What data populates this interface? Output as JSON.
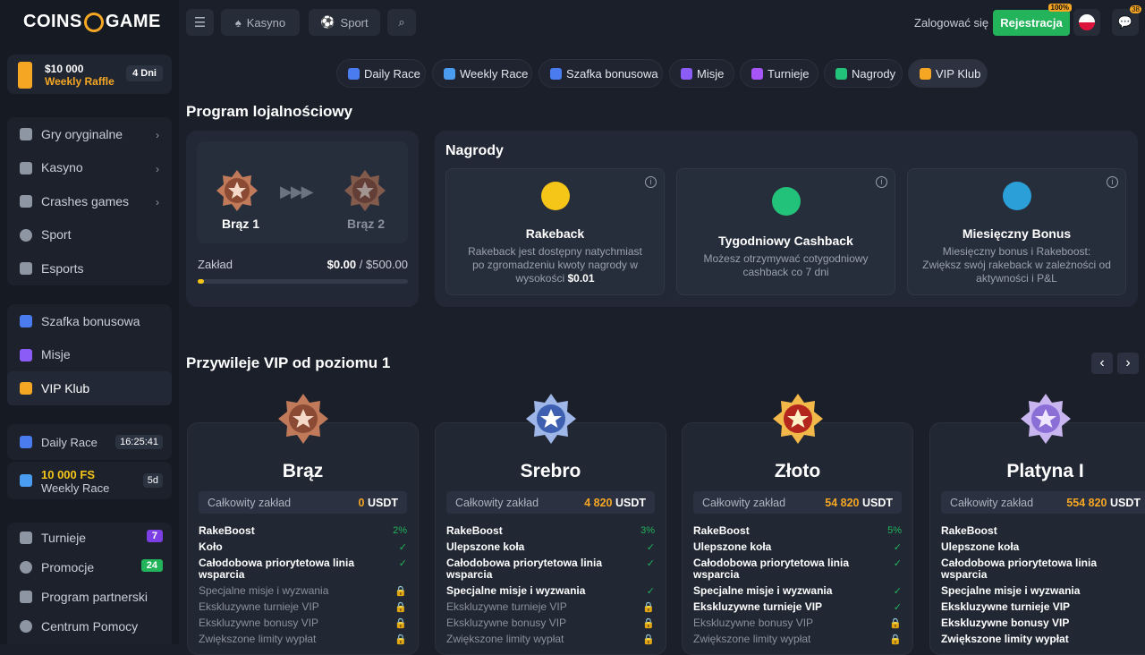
{
  "sidebar": {
    "logo_left": "COINS",
    "logo_right": "GAME",
    "raffle": {
      "amount": "$10 000",
      "label": "Weekly Raffle",
      "days": "4 Dni"
    },
    "menu1": [
      {
        "label": "Gry oryginalne",
        "icon": "rocket-icon"
      },
      {
        "label": "Kasyno",
        "icon": "spade-icon"
      },
      {
        "label": "Crashes games",
        "icon": "crash-icon"
      },
      {
        "label": "Sport",
        "icon": "ball-icon"
      },
      {
        "label": "Esports",
        "icon": "gamepad-icon"
      }
    ],
    "menu2": [
      {
        "label": "Szafka bonusowa",
        "icon": "gift-icon"
      },
      {
        "label": "Misje",
        "icon": "grid-icon"
      },
      {
        "label": "VIP Klub",
        "icon": "crown-icon"
      }
    ],
    "daily_race": {
      "label": "Daily Race",
      "timer": "16:25:41"
    },
    "weekly_race": {
      "amount": "10 000 FS",
      "label": "Weekly Race",
      "days": "5d"
    },
    "menu3": [
      {
        "label": "Turnieje",
        "badge": "7",
        "badge_color": "#7b3fe4"
      },
      {
        "label": "Promocje",
        "badge": "24",
        "badge_color": "#22b35b"
      },
      {
        "label": "Program partnerski"
      },
      {
        "label": "Centrum Pomocy"
      }
    ]
  },
  "topbar": {
    "casino": "Kasyno",
    "sport": "Sport",
    "login": "Zalogować się",
    "register": "Rejestracja",
    "register_badge": "100%",
    "chat_badge": "38"
  },
  "tabs": [
    "Daily Race",
    "Weekly Race",
    "Szafka bonusowa",
    "Misje",
    "Turnieje",
    "Nagrody",
    "VIP Klub"
  ],
  "loyalty": {
    "heading": "Program lojalnościowy",
    "current": "Brąz 1",
    "next": "Brąz 2",
    "wager_label": "Zakład",
    "wager_value": "$0.00",
    "wager_target": "/ $500.00",
    "progress": 0.03
  },
  "rewards": {
    "heading": "Nagrody",
    "cards": [
      {
        "title": "Rakeback",
        "desc": "Rakeback jest dostępny natychmiast po zgromadzeniu kwoty nagrody w wysokości",
        "desc_bold": "$0.01",
        "color": "#f5c518"
      },
      {
        "title": "Tygodniowy Cashback",
        "desc": "Możesz otrzymywać cotygodniowy cashback co 7 dni",
        "desc_bold": "",
        "color": "#22c27a"
      },
      {
        "title": "Miesięczny Bonus",
        "desc": "Miesięczny bonus i Rakeboost: Zwiększ swój rakeback w zależności od aktywności i P&L",
        "desc_bold": "",
        "color": "#2a9fd8"
      }
    ]
  },
  "vip": {
    "heading": "Przywileje VIP od poziomu 1",
    "wager_label": "Całkowity zakład",
    "currency": "USDT",
    "tiers": [
      {
        "name": "Brąz",
        "wager": "0",
        "perks": [
          [
            "RakeBoost",
            "2%",
            1
          ],
          [
            "Koło",
            "✓",
            1
          ],
          [
            "Całodobowa priorytetowa linia wsparcia",
            "✓",
            1
          ],
          [
            "Specjalne misje i wyzwania",
            "🔒",
            0
          ],
          [
            "Ekskluzywne turnieje VIP",
            "🔒",
            0
          ],
          [
            "Ekskluzywne bonusy VIP",
            "🔒",
            0
          ],
          [
            "Zwiększone limity wypłat",
            "🔒",
            0
          ]
        ]
      },
      {
        "name": "Srebro",
        "wager": "4 820",
        "perks": [
          [
            "RakeBoost",
            "3%",
            1
          ],
          [
            "Ulepszone koła",
            "✓",
            1
          ],
          [
            "Całodobowa priorytetowa linia wsparcia",
            "✓",
            1
          ],
          [
            "Specjalne misje i wyzwania",
            "✓",
            1
          ],
          [
            "Ekskluzywne turnieje VIP",
            "🔒",
            0
          ],
          [
            "Ekskluzywne bonusy VIP",
            "🔒",
            0
          ],
          [
            "Zwiększone limity wypłat",
            "🔒",
            0
          ]
        ]
      },
      {
        "name": "Złoto",
        "wager": "54 820",
        "perks": [
          [
            "RakeBoost",
            "5%",
            1
          ],
          [
            "Ulepszone koła",
            "✓",
            1
          ],
          [
            "Całodobowa priorytetowa linia wsparcia",
            "✓",
            1
          ],
          [
            "Specjalne misje i wyzwania",
            "✓",
            1
          ],
          [
            "Ekskluzywne turnieje VIP",
            "✓",
            1
          ],
          [
            "Ekskluzywne bonusy VIP",
            "🔒",
            0
          ],
          [
            "Zwiększone limity wypłat",
            "🔒",
            0
          ]
        ]
      },
      {
        "name": "Platyna I",
        "wager": "554 820",
        "perks": [
          [
            "RakeBoost",
            "",
            1
          ],
          [
            "Ulepszone koła",
            "",
            1
          ],
          [
            "Całodobowa priorytetowa linia wsparcia",
            "",
            1
          ],
          [
            "Specjalne misje i wyzwania",
            "",
            1
          ],
          [
            "Ekskluzywne turnieje VIP",
            "",
            1
          ],
          [
            "Ekskluzywne bonusy VIP",
            "",
            1
          ],
          [
            "Zwiększone limity wypłat",
            "",
            1
          ]
        ]
      }
    ]
  }
}
